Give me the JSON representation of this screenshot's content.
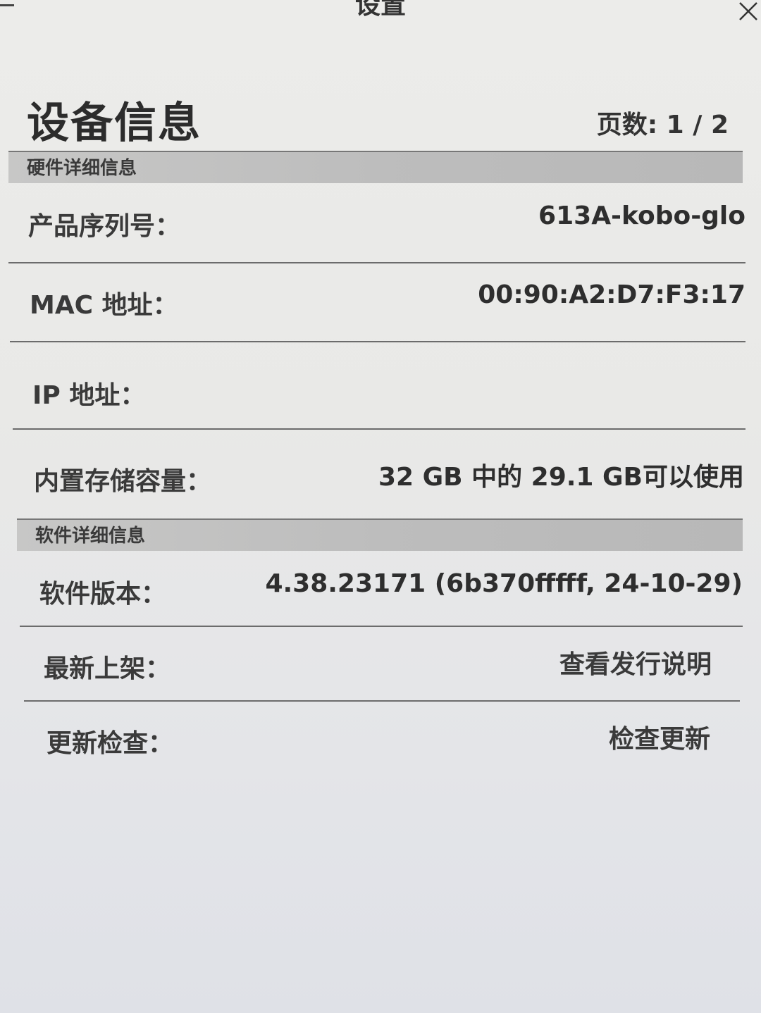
{
  "window": {
    "title": "设置",
    "close_icon": "close-icon",
    "minimize_icon": "minimize-icon"
  },
  "page": {
    "title": "设备信息",
    "page_indicator": "页数: 1 / 2"
  },
  "hardware": {
    "header": "硬件详细信息",
    "rows": [
      {
        "label": "产品序列号：",
        "value": "613A-kobo-glo"
      },
      {
        "label": "MAC 地址：",
        "value": "00:90:A2:D7:F3:17"
      },
      {
        "label": "IP 地址：",
        "value": ""
      },
      {
        "label": "内置存储容量：",
        "value": "32 GB 中的 29.1 GB可以使用"
      }
    ]
  },
  "software": {
    "header": "软件详细信息",
    "rows": [
      {
        "label": "软件版本：",
        "value": "4.38.23171 (6b370fffff, 24-10-29)"
      },
      {
        "label": "最新上架：",
        "value": "查看发行说明"
      },
      {
        "label": "更新检查：",
        "value": "检查更新"
      }
    ]
  }
}
